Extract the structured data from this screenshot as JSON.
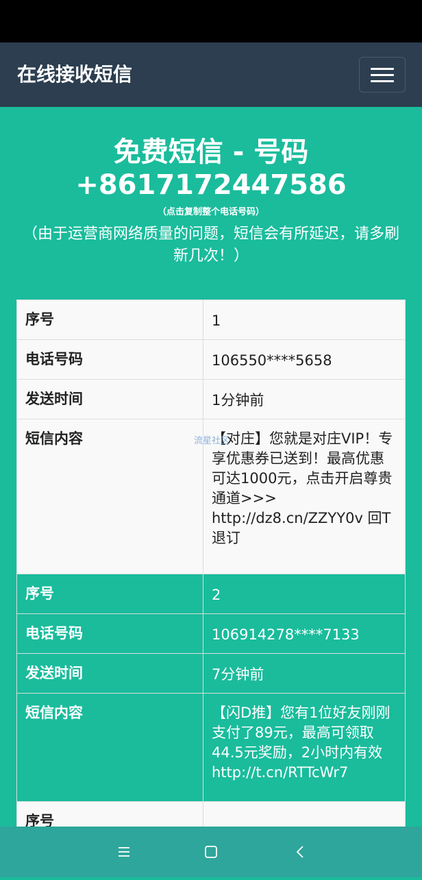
{
  "navbar": {
    "brand": "在线接收短信"
  },
  "hero": {
    "title": "免费短信 - 号码",
    "number": "+8617172447586",
    "hint": "（点击复制整个电话号码）",
    "note": "（由于运营商网络质量的问题，短信会有所延迟，请多刷新几次！）"
  },
  "watermark": "流星社区",
  "labels": {
    "seq": "序号",
    "phone": "电话号码",
    "time": "发送时间",
    "content": "短信内容"
  },
  "messages": [
    {
      "seq": "1",
      "phone": "106550****5658",
      "time": "1分钟前",
      "content": "【对庄】您就是对庄VIP！专享优惠券已送到！最高优惠可达1000元，点击开启尊贵通道>>> http://dz8.cn/ZZYY0v 回T退订"
    },
    {
      "seq": "2",
      "phone": "106914278****7133",
      "time": "7分钟前",
      "content": "【闪D推】您有1位好友刚刚支付了89元，最高可领取44.5元奖励，2小时内有效 http://t.cn/RTTcWr7"
    }
  ],
  "colors": {
    "navbar": "#2c3e50",
    "background": "#1abc9c",
    "system_nav": "#2ea69b"
  },
  "system_nav": {
    "icons": [
      "menu-icon",
      "home-square-icon",
      "back-chevron-icon"
    ]
  }
}
